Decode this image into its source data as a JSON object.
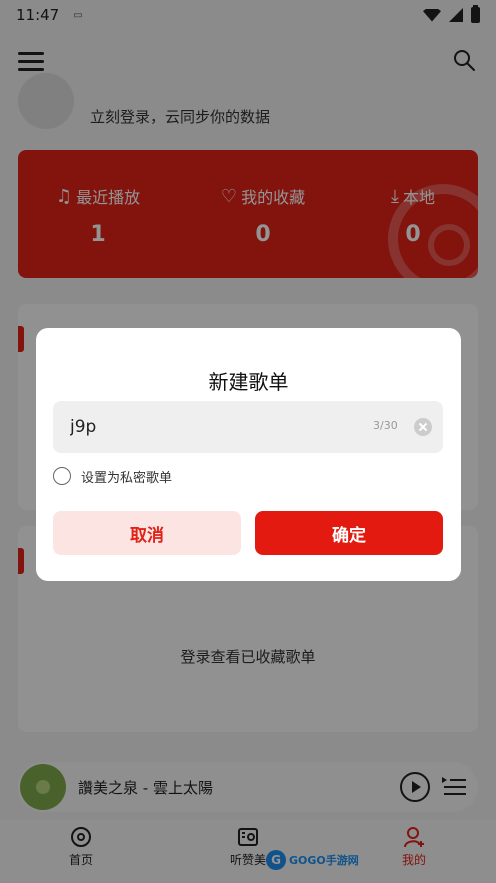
{
  "status_bar": {
    "time": "11:47",
    "notification_icon": "notification-icon"
  },
  "header": {
    "menu_icon": "menu-icon",
    "search_icon": "search-icon"
  },
  "login": {
    "prompt": "立刻登录，云同步你的数据"
  },
  "stats": [
    {
      "label": "最近播放",
      "value": "1",
      "icon": "music-note-icon"
    },
    {
      "label": "我的收藏",
      "value": "0",
      "icon": "heart-icon"
    },
    {
      "label": "本地",
      "value": "0",
      "icon": "download-icon"
    }
  ],
  "collection_section": {
    "empty_text": "登录查看已收藏歌单"
  },
  "player": {
    "song_title": "讚美之泉 - 雲上太陽"
  },
  "bottom_nav": [
    {
      "label": "首页",
      "icon": "home-disc-icon"
    },
    {
      "label": "听赞美",
      "icon": "radio-icon"
    },
    {
      "label": "我的",
      "icon": "profile-icon"
    }
  ],
  "watermark": {
    "text": "GOGO手游网"
  },
  "dialog": {
    "title": "新建歌单",
    "input_value": "j9p",
    "char_count": "3/30",
    "private_label": "设置为私密歌单",
    "cancel_label": "取消",
    "confirm_label": "确定"
  },
  "colors": {
    "accent": "#e02218",
    "cancel_bg": "#fbe4e2"
  }
}
